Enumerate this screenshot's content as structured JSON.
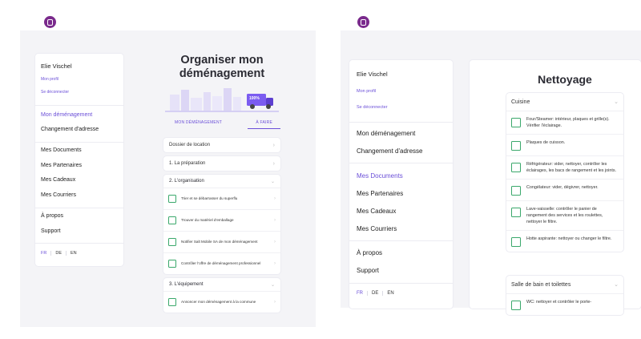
{
  "left": {
    "user_name": "Elie Vischel",
    "profile_link": "Mon profil",
    "logout_link": "Se déconnecter",
    "nav_primary": [
      "Mon déménagement",
      "Changement d'adresse"
    ],
    "nav_secondary": [
      "Mes Documents",
      "Mes Partenaires",
      "Mes Cadeaux",
      "Mes Courriers"
    ],
    "nav_tertiary": [
      "À propos",
      "Support"
    ],
    "langs": [
      "FR",
      "DE",
      "EN"
    ],
    "title": "Organiser mon déménagement",
    "truck_badge": "100%",
    "tabs": [
      "MON DÉMÉNAGEMENT",
      "À FAIRE"
    ],
    "rows": [
      "Dossier de location",
      "1. La préparation"
    ],
    "groups": [
      {
        "title": "2. L'organisation",
        "tasks": [
          "Trier et se débarrasser du superflu",
          "Trouver du matériel d'emballage",
          "Notifier Salt Mobile SA de mon déménagement",
          "Contrôler l'offre de déménagement professionnel"
        ]
      },
      {
        "title": "3. L'équipement",
        "tasks": [
          "Annoncer mon déménagement à la commune"
        ]
      }
    ]
  },
  "right": {
    "user_name": "Elie Vischel",
    "profile_link": "Mon profil",
    "logout_link": "Se déconnecter",
    "nav_primary": [
      "Mon déménagement",
      "Changement d'adresse"
    ],
    "nav_secondary": [
      "Mes Documents",
      "Mes Partenaires",
      "Mes Cadeaux",
      "Mes Courriers"
    ],
    "nav_tertiary": [
      "À propos",
      "Support"
    ],
    "langs": [
      "FR",
      "DE",
      "EN"
    ],
    "title": "Nettoyage",
    "sections": [
      {
        "title": "Cuisine",
        "tasks": [
          "Four/Steamer: intérieur, plaques et grille(s). Vérifier l'éclairage.",
          "Plaques de cuisson.",
          "Réfrigérateur: vider, nettoyer, contrôler les éclairages, les bacs de rangement et les joints.",
          "Congélateur: vider, dégivrer, nettoyer.",
          "Lave-vaisselle: contrôler le panier de rangement des services et les roulettes, nettoyer le filtre.",
          "Hotte aspirante: nettoyer ou changer le filtre."
        ]
      },
      {
        "title": "Salle de bain et toilettes",
        "tasks": [
          "WC: nettoyer et contrôler le porte-"
        ]
      }
    ]
  },
  "colors": {
    "accent": "#6b4fd8",
    "logo": "#7a2a8c",
    "checkbox": "#3aa86b",
    "truck": "#7b5cf0",
    "bg_panel": "#f4f4f7"
  }
}
